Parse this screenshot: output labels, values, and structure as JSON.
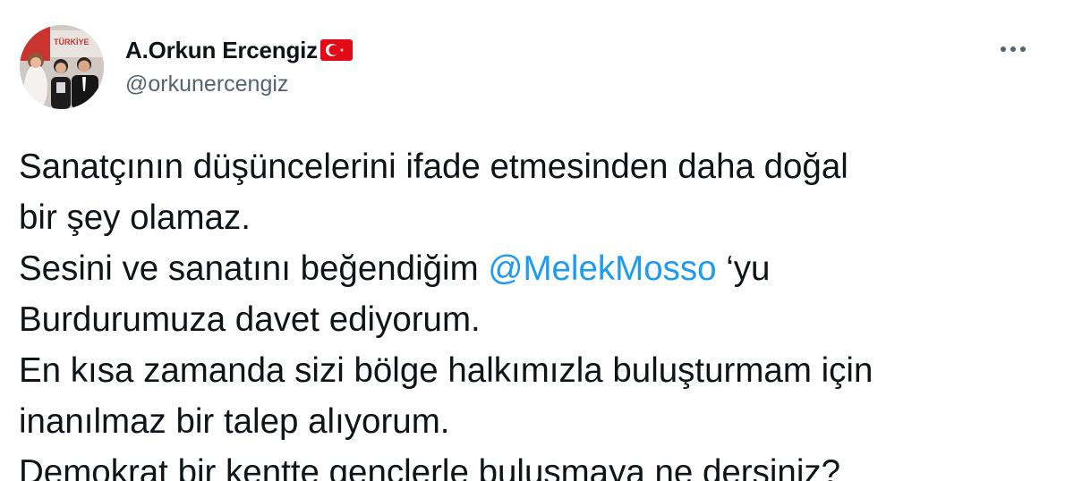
{
  "user": {
    "display_name": "A.Orkun Ercengiz",
    "flag_icon": "turkey-flag-icon",
    "handle": "@orkunercengiz",
    "avatar_icon": "profile-photo-avatar",
    "avatar_banner_text": "TÜRKİYE"
  },
  "more_menu": {
    "icon": "more-horizontal-icon"
  },
  "tweet": {
    "line1": "Sanatçının düşüncelerini ifade etmesinden daha doğal",
    "line2": "bir şey olamaz.",
    "line3_before": "Sesini ve sanatını beğendiğim ",
    "mention": "@MelekMosso",
    "line3_after": " ‘yu",
    "line4": "Burdurumuza davet ediyorum.",
    "line5": "En kısa zamanda sizi bölge halkımızla buluşturmam için",
    "line6": "inanılmaz bir talep alıyorum.",
    "line7": "Demokrat bir kentte gençlerle buluşmaya ne dersiniz?"
  },
  "colors": {
    "text": "#0f1419",
    "secondary": "#536471",
    "link": "#1d9bf0",
    "flag_red": "#e30a17"
  }
}
